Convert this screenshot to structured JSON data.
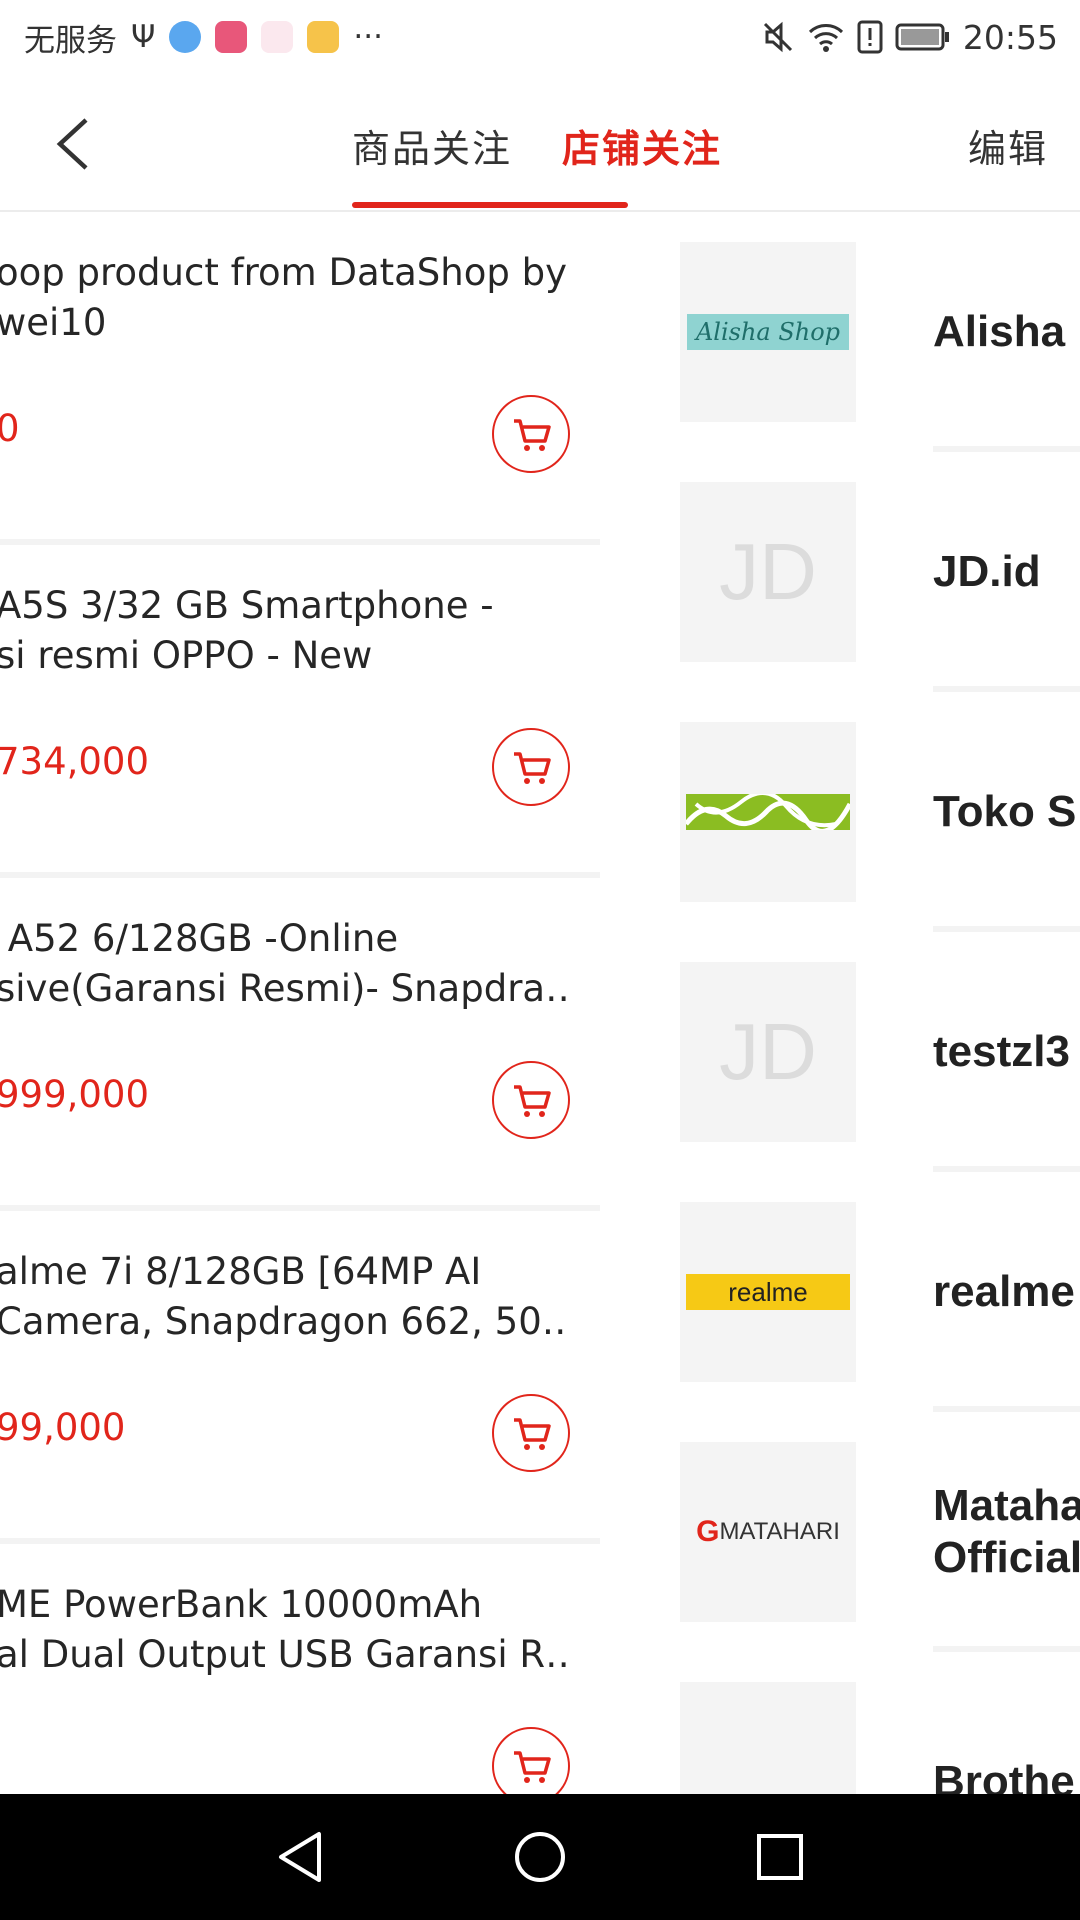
{
  "status_bar": {
    "carrier": "无服务",
    "time": "20:55"
  },
  "header": {
    "tabs": [
      {
        "label": "商品关注",
        "active": false
      },
      {
        "label": "店铺关注",
        "active": true
      }
    ],
    "edit_label": "编辑"
  },
  "products": [
    {
      "title": "oop product from DataShop by\nwei10",
      "price": "0"
    },
    {
      "title": "A5S 3/32 GB Smartphone -\nsi resmi OPPO - New",
      "price": "734,000"
    },
    {
      "title": " A52 6/128GB -Online\nsive(Garansi Resmi)- Snapdra…",
      "price": "999,000"
    },
    {
      "title": "alme 7i 8/128GB [64MP AI\nCamera, Snapdragon 662, 50…",
      "price": "99,000"
    },
    {
      "title": "ME PowerBank 10000mAh\nal Dual Output USB Garansi R…",
      "price": ""
    }
  ],
  "shops": [
    {
      "name": "Alisha",
      "logo_text": "Alisha Shop"
    },
    {
      "name": "JD.id",
      "logo_text": "JD"
    },
    {
      "name": "Toko S",
      "logo_text": ""
    },
    {
      "name": "testzl3",
      "logo_text": "JD"
    },
    {
      "name": "realme",
      "logo_text": "realme"
    },
    {
      "name": "Mataha\nOfficial",
      "logo_text": "MATAHARI"
    },
    {
      "name": "Brothe",
      "logo_text": ""
    }
  ],
  "colors": {
    "accent": "#e1251b"
  }
}
